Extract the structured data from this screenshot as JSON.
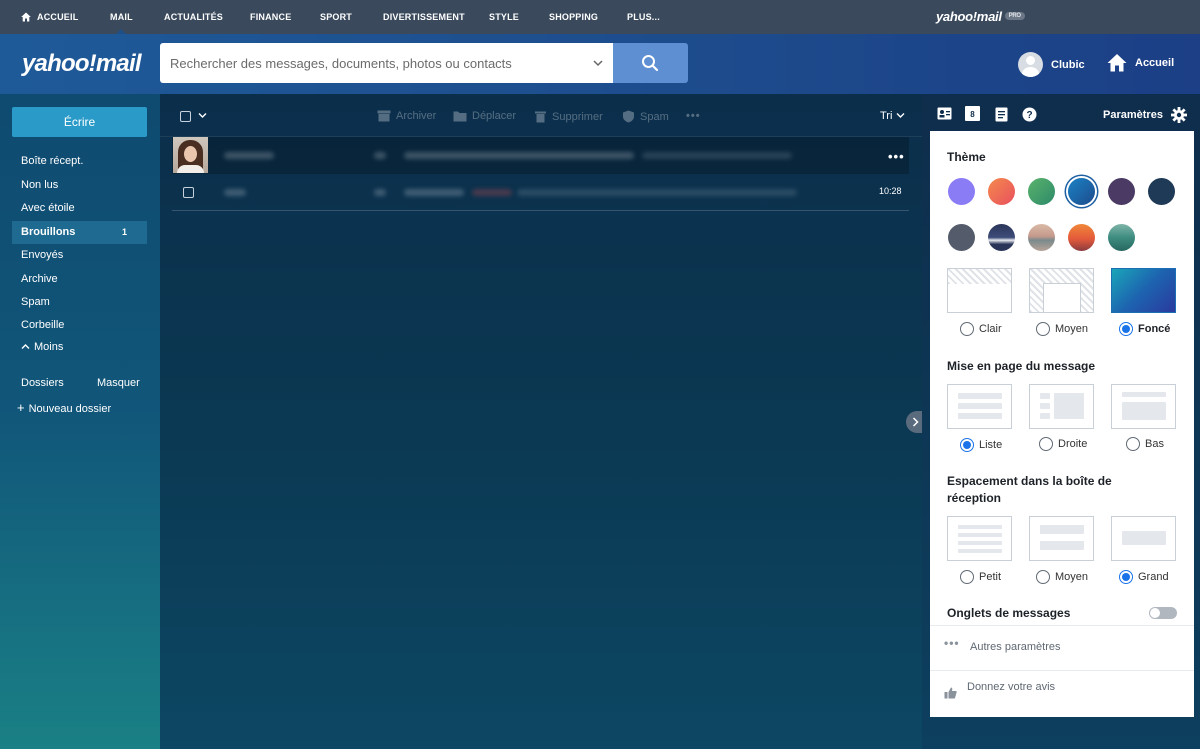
{
  "topnav": {
    "items": [
      {
        "label": "ACCUEIL",
        "active": false
      },
      {
        "label": "MAIL",
        "active": true
      },
      {
        "label": "ACTUALITÉS",
        "active": false
      },
      {
        "label": "FINANCE",
        "active": false
      },
      {
        "label": "SPORT",
        "active": false
      },
      {
        "label": "DIVERTISSEMENT",
        "active": false
      },
      {
        "label": "STYLE",
        "active": false
      },
      {
        "label": "SHOPPING",
        "active": false
      },
      {
        "label": "PLUS...",
        "active": false
      }
    ],
    "brand": "yahoo!mail",
    "brand_badge": "PRO"
  },
  "header": {
    "logo": "yahoo!mail",
    "search_placeholder": "Rechercher des messages, documents, photos ou contacts",
    "user_name": "Clubic",
    "home_label": "Accueil"
  },
  "sidebar": {
    "compose_label": "Écrire",
    "folders": [
      {
        "label": "Boîte récept.",
        "count": ""
      },
      {
        "label": "Non lus",
        "count": ""
      },
      {
        "label": "Avec étoile",
        "count": ""
      },
      {
        "label": "Brouillons",
        "count": "1"
      },
      {
        "label": "Envoyés",
        "count": ""
      },
      {
        "label": "Archive",
        "count": ""
      },
      {
        "label": "Spam",
        "count": ""
      },
      {
        "label": "Corbeille",
        "count": ""
      }
    ],
    "less_label": "Moins",
    "dossiers_label": "Dossiers",
    "hide_label": "Masquer",
    "new_folder_label": "Nouveau dossier"
  },
  "toolbar": {
    "archive": "Archiver",
    "move": "Déplacer",
    "delete": "Supprimer",
    "spam": "Spam",
    "sort": "Tri"
  },
  "messages": [
    {
      "time": ""
    },
    {
      "time": "10:28"
    }
  ],
  "right_panel": {
    "calendar_day": "8",
    "settings_label": "Paramètres"
  },
  "settings": {
    "theme_title": "Thème",
    "theme_colors": [
      "#8a7cf5",
      "#ee6a56",
      "#3fa36b",
      "#1a6fb5",
      "#4a3a64",
      "#1e3a56",
      "#545b6a"
    ],
    "theme_images": [
      "night-mountains",
      "desert",
      "sunset",
      "forest"
    ],
    "contrast_options": [
      {
        "label": "Clair",
        "selected": false
      },
      {
        "label": "Moyen",
        "selected": false
      },
      {
        "label": "Foncé",
        "selected": true
      }
    ],
    "layout_title": "Mise en page du message",
    "layout_options": [
      {
        "label": "Liste",
        "selected": true
      },
      {
        "label": "Droite",
        "selected": false
      },
      {
        "label": "Bas",
        "selected": false
      }
    ],
    "spacing_title": "Espacement dans la boîte de réception",
    "spacing_options": [
      {
        "label": "Petit",
        "selected": false
      },
      {
        "label": "Moyen",
        "selected": false
      },
      {
        "label": "Grand",
        "selected": true
      }
    ],
    "tabs_title": "Onglets de messages",
    "tabs_enabled": false,
    "more_settings": "Autres paramètres",
    "feedback": "Donnez votre avis"
  },
  "colors": {
    "topnav_bg": "#3a4a5c",
    "header_bg": "#1f5a98",
    "accent": "#1a73e8",
    "compose": "#2a9bc8"
  }
}
